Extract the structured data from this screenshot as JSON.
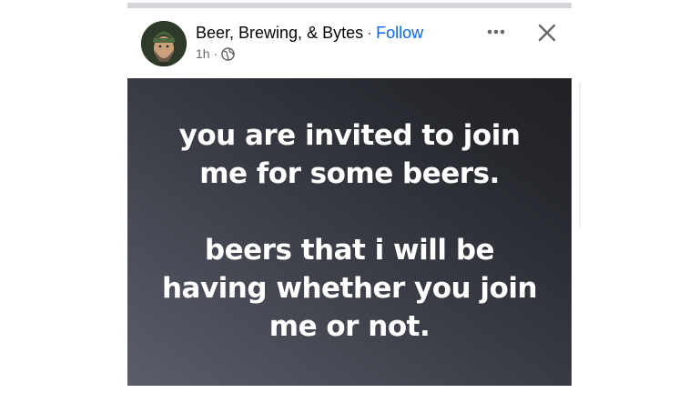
{
  "header": {
    "page_name": "Beer, Brewing, & Bytes",
    "separator": "·",
    "follow_label": "Follow",
    "timestamp": "1h",
    "meta_separator": "·",
    "privacy_icon": "globe-icon",
    "more_icon": "more-horizontal-icon",
    "close_icon": "close-icon"
  },
  "post": {
    "line_1": "you are invited to join",
    "line_2": "me for some beers.",
    "line_3": "beers that i will be",
    "line_4": "having whether you join",
    "line_5": "me or not."
  },
  "colors": {
    "follow": "#0866ff",
    "meta_text": "#65676b",
    "card_dark": "#1f2125",
    "card_light": "#5b5e6a"
  }
}
